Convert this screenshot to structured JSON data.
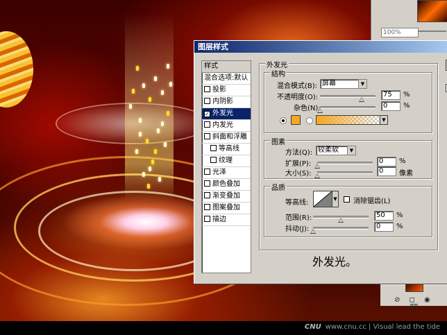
{
  "palette": {
    "zoom_text": "100%"
  },
  "watermark": {
    "brand": "CNU",
    "url": "www.cnu.cc",
    "tagline": "| Visual lead the tide"
  },
  "dialog": {
    "title": "图层样式",
    "styles_list": {
      "header": "样式",
      "blend_options": "混合选项:默认",
      "items": [
        {
          "label": "投影",
          "checked": false
        },
        {
          "label": "内阴影",
          "checked": false
        },
        {
          "label": "外发光",
          "checked": true,
          "selected": true
        },
        {
          "label": "内发光",
          "checked": false
        },
        {
          "label": "斜面和浮雕",
          "checked": false
        },
        {
          "label": "等高线",
          "checked": false,
          "indent": true
        },
        {
          "label": "纹理",
          "checked": false,
          "indent": true
        },
        {
          "label": "光泽",
          "checked": false
        },
        {
          "label": "颜色叠加",
          "checked": false
        },
        {
          "label": "渐变叠加",
          "checked": false
        },
        {
          "label": "图案叠加",
          "checked": false
        },
        {
          "label": "描边",
          "checked": false
        }
      ]
    },
    "outer_glow": {
      "title": "外发光",
      "structure": {
        "title": "结构",
        "blend_mode_label": "混合模式(B):",
        "blend_mode_value": "屏幕",
        "opacity_label": "不透明度(O):",
        "opacity_value": "75",
        "noise_label": "杂色(N):",
        "noise_value": "0",
        "percent": "%",
        "color_swatch": "#f5a623",
        "gradient_from": "#f5a623"
      },
      "elements": {
        "title": "图素",
        "technique_label": "方法(Q):",
        "technique_value": "较柔软",
        "spread_label": "扩展(P):",
        "spread_value": "0",
        "size_label": "大小(S):",
        "size_value": "0",
        "percent": "%",
        "px_unit": "像素"
      },
      "quality": {
        "title": "品质",
        "contour_label": "等高线:",
        "antialias_label": "消除锯齿(L)",
        "range_label": "范围(R):",
        "range_value": "50",
        "jitter_label": "抖动(J):",
        "jitter_value": "0",
        "percent": "%"
      },
      "caption": "外发光。"
    }
  }
}
